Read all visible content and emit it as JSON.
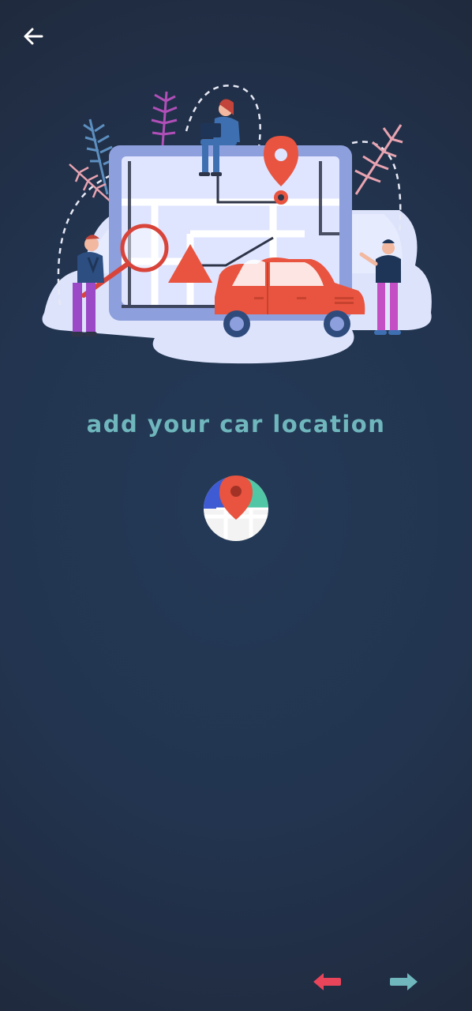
{
  "header": {
    "back_icon": "arrow-left-icon"
  },
  "illustration": {
    "description_icon": "car-location-map-illustration",
    "colors": {
      "car": "#e8543f",
      "map_frame": "#8d9fdc",
      "map_bg": "#dfe4ff",
      "pin": "#e8543f",
      "ground": "#dde3fb"
    }
  },
  "content": {
    "title": "add your car location",
    "title_color": "#6fb6bd",
    "location_button_icon": "map-pin-location-icon"
  },
  "footer": {
    "prev_icon": "arrow-left-icon",
    "prev_color": "#e8455a",
    "next_icon": "arrow-right-icon",
    "next_color": "#6fb6bd"
  }
}
